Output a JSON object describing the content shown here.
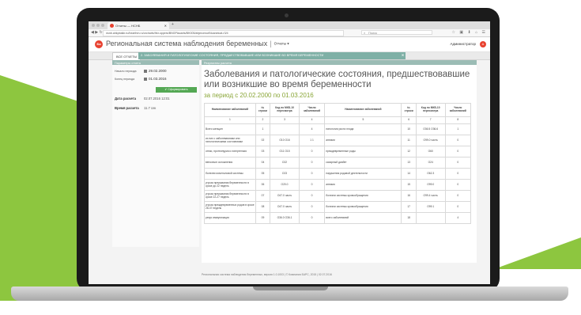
{
  "browser": {
    "tab_title": "Отчеты — НСНБ",
    "url": "nsnb.ahkpbaikr.ru/hearthm.ru/orcharts/frkr.oppers/BNGPlaoarts/BK005/ahjmcenut/Noanelcat-r3/4",
    "search_placeholder": "Поиск",
    "nav": "◀ ▶ ↻",
    "tools": "☆ ▣ ⬇ ⌂ ☰"
  },
  "app": {
    "logo": "Ба",
    "title": "Региональная система наблюдения беременных",
    "subtitle": "Отчеты ▾",
    "user": "Администратор",
    "user_badge": "А"
  },
  "tabs": {
    "all_reports": "ВСЕ ОТЧЕТЫ",
    "active": "2. ЗАБОЛЕВАНИЯ И ПАТОЛОГИЧЕСКИЕ СОСТОЯНИЯ, ПРЕДШЕСТВОВАВШИЕ ИЛИ ВОЗНИКШИЕ ВО ВРЕМЯ БЕРЕМЕННОСТИ",
    "close": "✕"
  },
  "left": {
    "header": "Параметры отчета",
    "from_label": "Начало периода",
    "from_date": "29.02.2000",
    "to_label": "Конец периода",
    "to_date": "01.03.2016",
    "generate": "✔ Сформировать",
    "calc_date_label": "Дата расчета",
    "calc_date_value": "02.07.2016 12:01",
    "calc_time_label": "Время расчета",
    "calc_time_value": "11.7 сек"
  },
  "main": {
    "header": "Результаты расчета",
    "title": "Заболевания и патологические состояния, предшествовавшие или возникшие во время беременности",
    "period": "за период с 20.02.2000 по 01.03.2016"
  },
  "table": {
    "headers": [
      "Наименование заболеваний",
      "№ строки",
      "Код по МКБ-10 пересмотра",
      "Число заболеваний",
      "Наименование заболеваний",
      "№ строки",
      "Код по МКБ-10 пересмотра",
      "Число заболеваний"
    ],
    "numbers": [
      "1",
      "2",
      "3",
      "4",
      "5",
      "6",
      "7",
      "8"
    ],
    "rows": [
      [
        "Всего женщин",
        "1",
        "",
        "4",
        "патология роста плода",
        "10",
        "O36.5 O36.6",
        "1"
      ],
      [
        "из них с заболеваниями или патологическими состояниями",
        "02",
        "O10 O16",
        "1 1",
        "анемии",
        "11",
        "O99.0 часть",
        "0"
      ],
      [
        "отеки, протеинурия и гипертензия",
        "03",
        "O11 O15",
        "0",
        "преждевременные роды",
        "12",
        "O60",
        "0"
      ],
      [
        "венозные осложнения",
        "04",
        "O22",
        "0",
        "сахарный диабет",
        "13",
        "O24",
        "0"
      ],
      [
        "болезни мочеполовой системы",
        "05",
        "O23",
        "0",
        "нарушения родовой деятельности",
        "14",
        "O62.3",
        "0"
      ],
      [
        "угроза прерывания беременности в сроке до 22 недель",
        "06",
        "O20.0",
        "0",
        "анемия",
        "15",
        "O99.0",
        "0"
      ],
      [
        "угроза прерывания беременности в сроке 22-27 недель",
        "07",
        "O47.0 часть",
        "0",
        "болезни системы кровообращения",
        "16",
        "O99.4 часть",
        "0"
      ],
      [
        "угроза преждевременных родов в сроке 28-37 недель",
        "08",
        "O47.0 часть",
        "0",
        "болезни системы кровообращения",
        "17",
        "O99.1",
        "0"
      ],
      [
        "резус иммунизация",
        "09",
        "O36.0 O36.1",
        "0",
        "всего заболеваний",
        "18",
        "",
        "4"
      ]
    ]
  },
  "footer": "Региональная система наблюдения беременных, версия 1.0.1003 | © Компания БАРС, 2015 | 02.07.2016"
}
